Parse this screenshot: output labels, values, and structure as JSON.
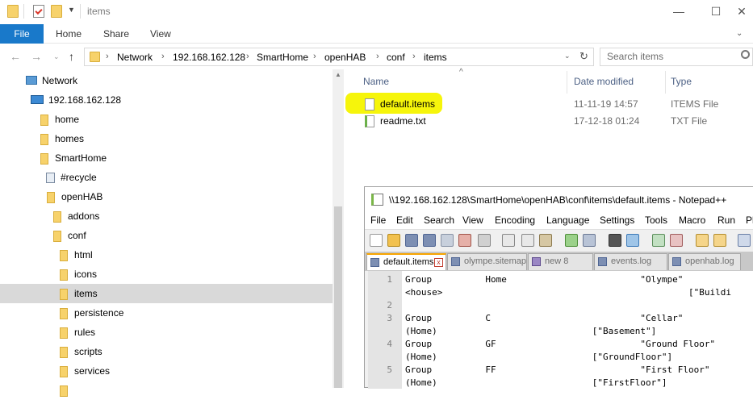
{
  "window": {
    "title": "items",
    "minimize": "—",
    "maximize": "☐",
    "close": "✕"
  },
  "ribbon": {
    "file": "File",
    "home": "Home",
    "share": "Share",
    "view": "View"
  },
  "address": {
    "crumbs": [
      "Network",
      "192.168.162.128",
      "SmartHome",
      "openHAB",
      "conf",
      "items"
    ],
    "search_placeholder": "Search items"
  },
  "nav": [
    {
      "label": "Network",
      "icon": "network-icon"
    },
    {
      "label": "192.168.162.128",
      "icon": "computer-icon"
    },
    {
      "label": "home",
      "icon": "folder-icon"
    },
    {
      "label": "homes",
      "icon": "folder-icon"
    },
    {
      "label": "SmartHome",
      "icon": "folder-icon"
    },
    {
      "label": "#recycle",
      "icon": "recycle-icon"
    },
    {
      "label": "openHAB",
      "icon": "folder-icon"
    },
    {
      "label": "addons",
      "icon": "folder-icon"
    },
    {
      "label": "conf",
      "icon": "folder-icon"
    },
    {
      "label": "html",
      "icon": "folder-icon"
    },
    {
      "label": "icons",
      "icon": "folder-icon"
    },
    {
      "label": "items",
      "icon": "folder-icon"
    },
    {
      "label": "persistence",
      "icon": "folder-icon"
    },
    {
      "label": "rules",
      "icon": "folder-icon"
    },
    {
      "label": "scripts",
      "icon": "folder-icon"
    },
    {
      "label": "services",
      "icon": "folder-icon"
    }
  ],
  "columns": {
    "name": "Name",
    "date": "Date modified",
    "type": "Type"
  },
  "files": [
    {
      "name": "default.items",
      "date": "11-11-19 14:57",
      "type": "ITEMS File"
    },
    {
      "name": "readme.txt",
      "date": "17-12-18 01:24",
      "type": "TXT File"
    }
  ],
  "notepad": {
    "title": "\\\\192.168.162.128\\SmartHome\\openHAB\\conf\\items\\default.items - Notepad++",
    "menu": [
      "File",
      "Edit",
      "Search",
      "View",
      "Encoding",
      "Language",
      "Settings",
      "Tools",
      "Macro",
      "Run",
      "Pl"
    ],
    "tabs": [
      "default.items",
      "olympe.sitemaps",
      "new 8",
      "events.log",
      "openhab.log"
    ],
    "lines": [
      {
        "num": "1",
        "text": "Group          Home                         \"Olympe\""
      },
      {
        "num": "",
        "text": "<house>                                              [\"Buildi"
      },
      {
        "num": "2",
        "text": ""
      },
      {
        "num": "3",
        "text": "Group          C                            \"Cellar\""
      },
      {
        "num": "",
        "text": "(Home)                             [\"Basement\"]"
      },
      {
        "num": "4",
        "text": "Group          GF                           \"Ground Floor\""
      },
      {
        "num": "",
        "text": "(Home)                             [\"GroundFloor\"]"
      },
      {
        "num": "5",
        "text": "Group          FF                           \"First Floor\""
      },
      {
        "num": "",
        "text": "(Home)                             [\"FirstFloor\"]"
      }
    ]
  },
  "colors": {
    "accent": "#1979ca",
    "highlight": "#f6f50b",
    "selected": "#d9d9d9"
  }
}
